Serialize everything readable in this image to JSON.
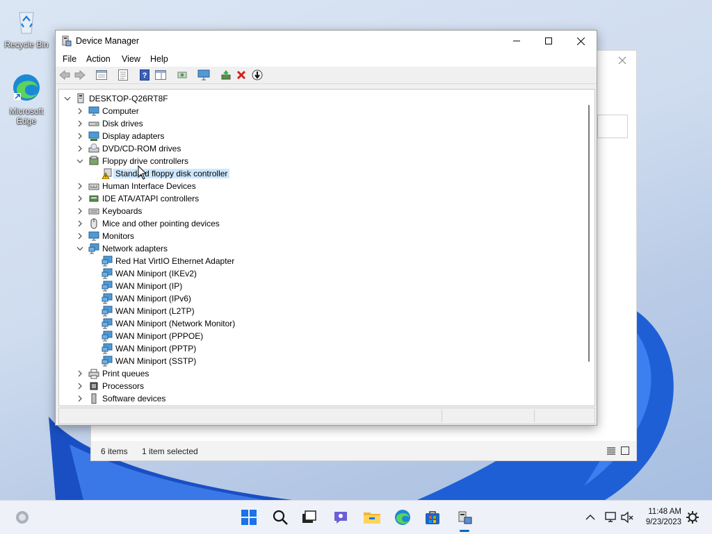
{
  "desktop": {
    "icons": [
      {
        "label": "Recycle Bin"
      },
      {
        "label": "Microsoft Edge"
      }
    ]
  },
  "background_window": {
    "status": {
      "items": "6 items",
      "selected": "1 item selected"
    }
  },
  "window": {
    "title": "Device Manager",
    "menu": [
      "File",
      "Action",
      "View",
      "Help"
    ],
    "tree": {
      "root": "DESKTOP-Q26RT8F",
      "rows": [
        {
          "label": "Computer",
          "icon": "computer-icon"
        },
        {
          "label": "Disk drives",
          "icon": "disk-drive-icon"
        },
        {
          "label": "Display adapters",
          "icon": "display-adapter-icon"
        },
        {
          "label": "DVD/CD-ROM drives",
          "icon": "dvd-drive-icon"
        },
        {
          "label": "Floppy drive controllers",
          "icon": "floppy-controller-icon",
          "expanded": true
        },
        {
          "label": "Standard floppy disk controller",
          "icon": "warning-device-icon",
          "child": true,
          "selected": true
        },
        {
          "label": "Human Interface Devices",
          "icon": "hid-icon"
        },
        {
          "label": "IDE ATA/ATAPI controllers",
          "icon": "ide-controller-icon"
        },
        {
          "label": "Keyboards",
          "icon": "keyboard-icon"
        },
        {
          "label": "Mice and other pointing devices",
          "icon": "mouse-icon"
        },
        {
          "label": "Monitors",
          "icon": "monitor-icon"
        },
        {
          "label": "Network adapters",
          "icon": "network-adapter-icon",
          "expanded": true
        },
        {
          "label": "Red Hat VirtIO Ethernet Adapter",
          "icon": "network-adapter-icon",
          "child": true
        },
        {
          "label": "WAN Miniport (IKEv2)",
          "icon": "network-adapter-icon",
          "child": true
        },
        {
          "label": "WAN Miniport (IP)",
          "icon": "network-adapter-icon",
          "child": true
        },
        {
          "label": "WAN Miniport (IPv6)",
          "icon": "network-adapter-icon",
          "child": true
        },
        {
          "label": "WAN Miniport (L2TP)",
          "icon": "network-adapter-icon",
          "child": true
        },
        {
          "label": "WAN Miniport (Network Monitor)",
          "icon": "network-adapter-icon",
          "child": true
        },
        {
          "label": "WAN Miniport (PPPOE)",
          "icon": "network-adapter-icon",
          "child": true
        },
        {
          "label": "WAN Miniport (PPTP)",
          "icon": "network-adapter-icon",
          "child": true
        },
        {
          "label": "WAN Miniport (SSTP)",
          "icon": "network-adapter-icon",
          "child": true
        },
        {
          "label": "Print queues",
          "icon": "printer-icon"
        },
        {
          "label": "Processors",
          "icon": "processor-icon"
        },
        {
          "label": "Software devices",
          "icon": "software-device-icon"
        }
      ]
    }
  },
  "taskbar": {
    "time": "11:48 AM",
    "date": "9/23/2023"
  },
  "colors": {
    "selection": "#cce8ff",
    "accent": "#0067c0",
    "warning": "#f5c400"
  }
}
